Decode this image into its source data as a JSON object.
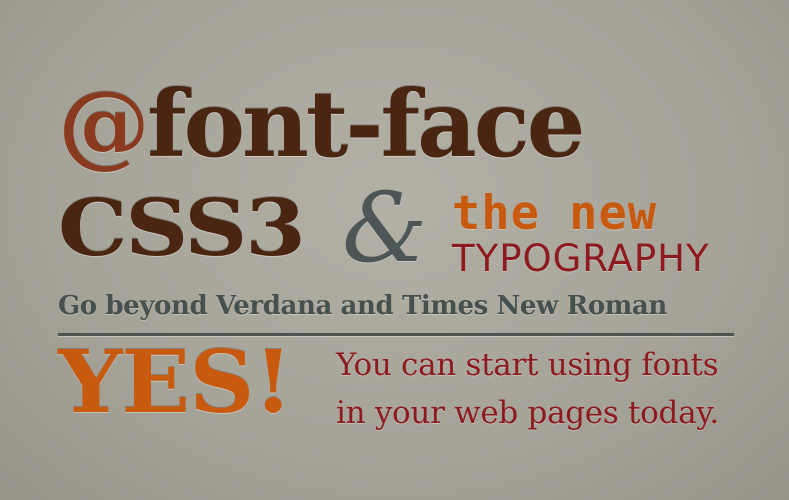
{
  "headline": {
    "at": "@",
    "font_face": "font-face"
  },
  "line2": {
    "css3": "CSS3",
    "amp": "&",
    "the_new": "the new",
    "typography": "TYPOGRAPHY"
  },
  "tagline": "Go beyond Verdana and Times New Roman",
  "callout": {
    "yes": "YES!",
    "message_line1": "You can start using fonts",
    "message_line2": "in your web pages today."
  },
  "colors": {
    "background": "#a8a69b",
    "dark_brown": "#4a2612",
    "rust": "#8a3a1e",
    "orange": "#c85a10",
    "crimson": "#8c1a1e",
    "slate": "#46504f"
  }
}
